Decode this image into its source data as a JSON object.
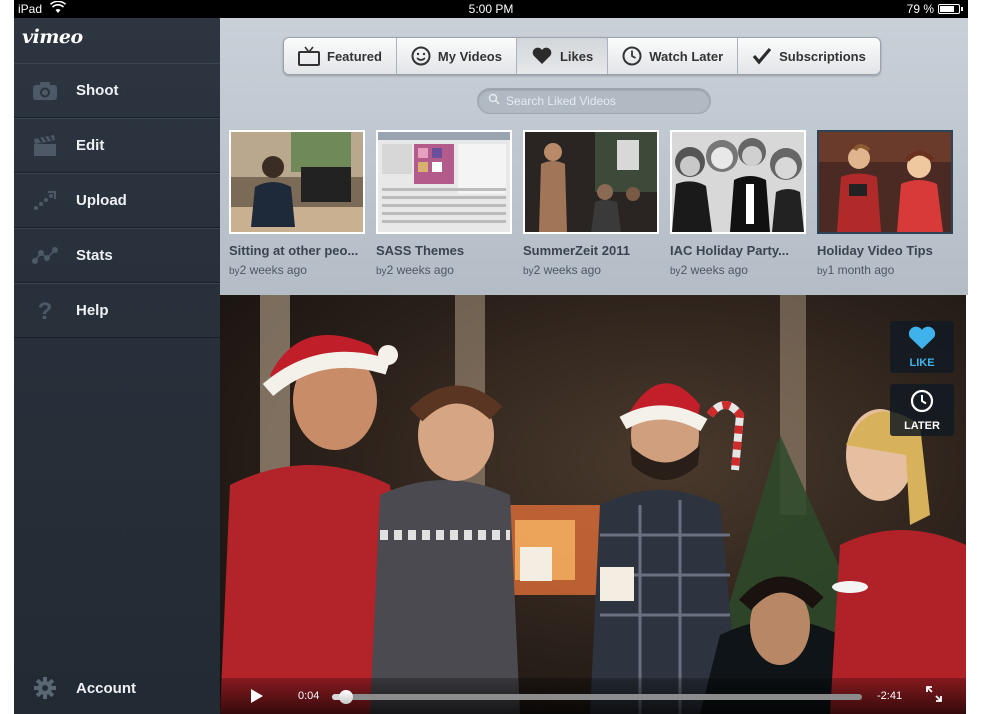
{
  "status_bar": {
    "carrier": "iPad",
    "time": "5:00 PM",
    "battery_percent": "79 %",
    "battery_level": 0.79
  },
  "sidebar": {
    "logo": "vimeo",
    "items": [
      {
        "label": "Shoot",
        "icon": "camera-icon"
      },
      {
        "label": "Edit",
        "icon": "clapperboard-icon"
      },
      {
        "label": "Upload",
        "icon": "upload-icon"
      },
      {
        "label": "Stats",
        "icon": "stats-icon"
      },
      {
        "label": "Help",
        "icon": "help-icon"
      }
    ],
    "account_label": "Account"
  },
  "tabs": [
    {
      "label": "Featured",
      "icon": "tv-icon",
      "active": false
    },
    {
      "label": "My Videos",
      "icon": "smiley-icon",
      "active": false
    },
    {
      "label": "Likes",
      "icon": "heart-icon",
      "active": true
    },
    {
      "label": "Watch Later",
      "icon": "clock-icon",
      "active": false
    },
    {
      "label": "Subscriptions",
      "icon": "checkmark-icon",
      "active": false
    }
  ],
  "search": {
    "placeholder": "Search Liked Videos"
  },
  "videos": [
    {
      "title": "Sitting at other peo...",
      "by": "by",
      "age": "2 weeks ago",
      "selected": false
    },
    {
      "title": "SASS Themes",
      "by": "by",
      "age": "2 weeks ago",
      "selected": false
    },
    {
      "title": "SummerZeit 2011",
      "by": "by",
      "age": "2 weeks ago",
      "selected": false
    },
    {
      "title": "IAC Holiday Party...",
      "by": "by",
      "age": "2 weeks ago",
      "selected": false
    },
    {
      "title": "Holiday Video Tips",
      "by": "by",
      "age": "1 month ago",
      "selected": true
    }
  ],
  "player": {
    "like_label": "LIKE",
    "later_label": "LATER",
    "elapsed": "0:04",
    "remaining": "-2:41",
    "progress": 0.027
  },
  "colors": {
    "accent_blue": "#3fb2ec",
    "sidebar_bg": "#27303a",
    "top_pane_bg": "#bfc6ce"
  }
}
